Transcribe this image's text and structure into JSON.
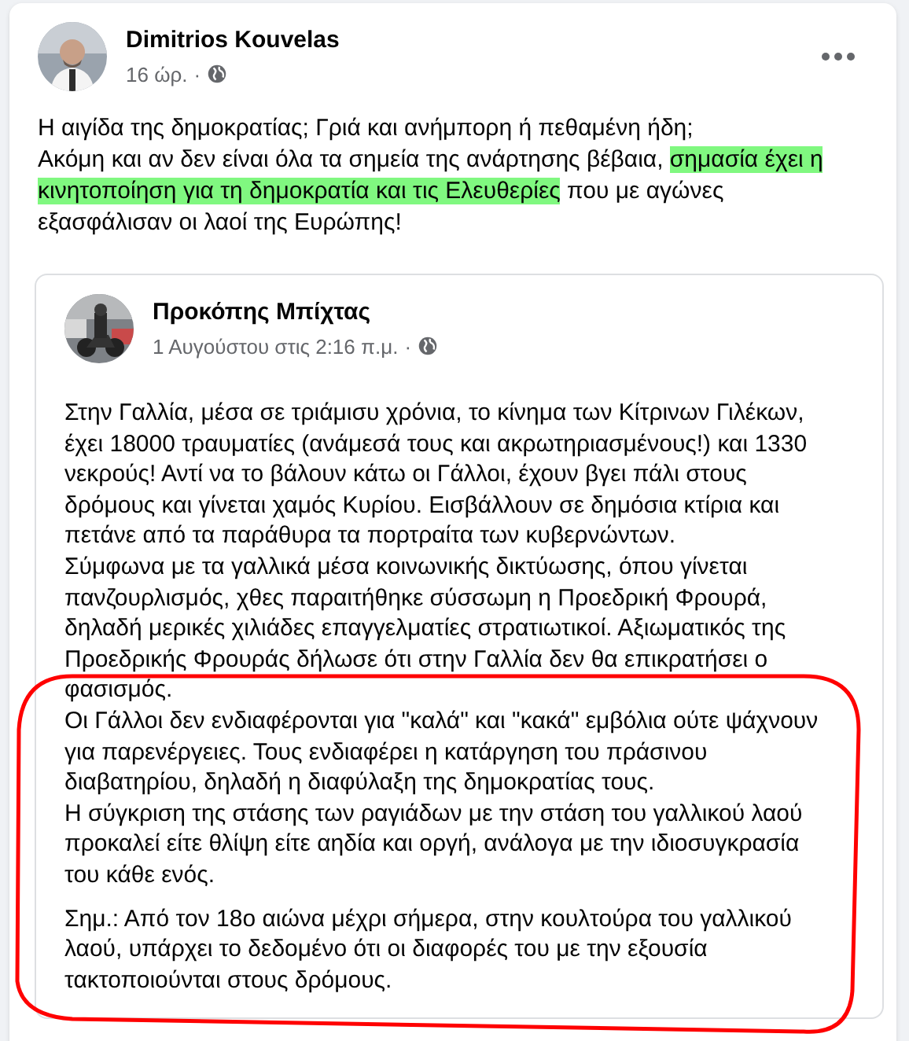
{
  "post": {
    "author": "Dimitrios Kouvelas",
    "time": "16 ώρ.",
    "separator": "·",
    "lines": [
      {
        "segments": [
          {
            "text": "Η αιγίδα της δημοκρατίας; Γριά και ανήμπορη ή πεθαμένη ήδη;",
            "highlighted": false
          }
        ]
      },
      {
        "segments": [
          {
            "text": "Ακόμη και αν δεν είναι όλα τα σημεία της ανάρτησης βέβαια, ",
            "highlighted": false
          },
          {
            "text": "σημασία έχει η κινητοποίηση για τη δημοκρατία και τις Ελευθερίες",
            "highlighted": true
          },
          {
            "text": " που με αγώνες εξασφάλισαν οι λαοί της Ευρώπης!",
            "highlighted": false
          }
        ]
      }
    ]
  },
  "shared_post": {
    "author": "Προκόπης Μπίχτας",
    "time": "1 Αυγούστου στις 2:16 π.μ.",
    "separator": "·",
    "paragraphs": [
      {
        "lines": [
          "Στην Γαλλία, μέσα σε τριάμισυ χρόνια, το κίνημα των Κίτρινων Γιλέκων, έχει 18000 τραυματίες (ανάμεσά τους και ακρωτηριασμένους!) και 1330 νεκρούς! Αντί να το βάλουν κάτω οι Γάλλοι, έχουν βγει πάλι στους δρόμους και γίνεται χαμός Κυρίου. Εισβάλλουν σε δημόσια κτίρια και πετάνε από τα παράθυρα τα πορτραίτα των κυβερνώντων.",
          "Σύμφωνα με τα γαλλικά μέσα κοινωνικής δικτύωσης, όπου γίνεται πανζουρλισμός, χθες παραιτήθηκε σύσσωμη η Προεδρική Φρουρά, δηλαδή μερικές χιλιάδες επαγγελματίες στρατιωτικοί. Αξιωματικός της Προεδρικής Φρουράς δήλωσε ότι στην Γαλλία δεν θα επικρατήσει ο φασισμός.",
          "Οι Γάλλοι δεν ενδιαφέρονται για \"καλά\" και \"κακά\" εμβόλια ούτε ψάχνουν για παρενέργειες. Τους ενδιαφέρει η κατάργηση του πράσινου διαβατηρίου, δηλαδή η διαφύλαξη της δημοκρατίας τους.",
          "Η σύγκριση της στάσης των ραγιάδων με την στάση του γαλλικού λαού προκαλεί είτε θλίψη είτε αηδία και οργή, ανάλογα με την ιδιοσυγκρασία του κάθε ενός."
        ]
      },
      {
        "lines": [
          "Σημ.: Από τον 18ο αιώνα μέχρι σήμερα, στην κουλτούρα του γαλλικού λαού, υπάρχει το δεδομένο ότι οι διαφορές του με την εξουσία τακτοποιούνται στους δρόμους."
        ]
      }
    ]
  }
}
